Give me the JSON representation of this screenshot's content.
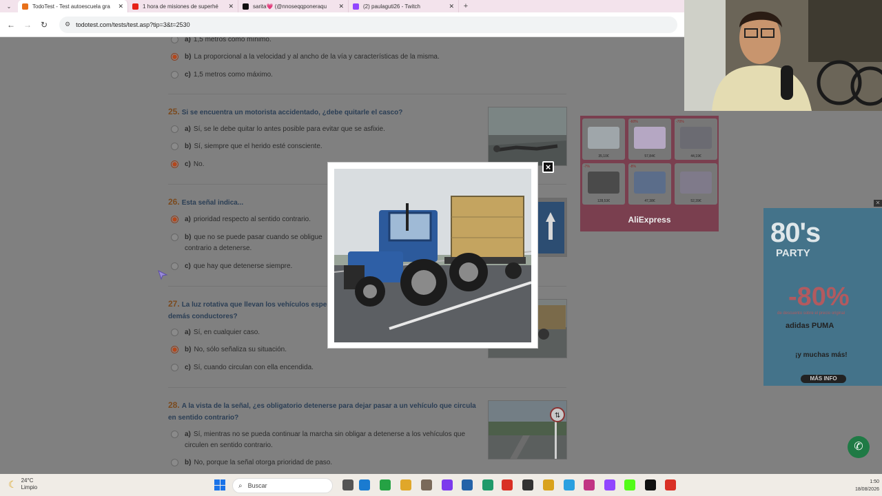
{
  "browser": {
    "tabs": [
      {
        "title": "TodoTest - Test autoescuela gra",
        "active": true,
        "favicon": "todotest-favicon",
        "color": "#e8711a"
      },
      {
        "title": "1 hora de misiones de superhé",
        "active": false,
        "favicon": "youtube-favicon",
        "color": "#e62117"
      },
      {
        "title": "sarita💗 (@nnoseqqponeraqu",
        "active": false,
        "favicon": "tiktok-favicon",
        "color": "#111111"
      },
      {
        "title": "(2) paulaguti26 - Twitch",
        "active": false,
        "favicon": "twitch-favicon",
        "color": "#9146ff"
      }
    ],
    "url": "todotest.com/tests/test.asp?tip=3&t=2530"
  },
  "questions": [
    {
      "number": "",
      "title": "",
      "options": [
        {
          "letter": "a)",
          "text": "1,5 metros como mínimo.",
          "checked": false
        },
        {
          "letter": "b)",
          "text": "La proporcional a la velocidad y al ancho de la vía y características de la misma.",
          "checked": true
        },
        {
          "letter": "c)",
          "text": "1,5 metros como máximo.",
          "checked": false
        }
      ]
    },
    {
      "number": "25.",
      "title": "Si se encuentra un motorista accidentado, ¿debe quitarle el casco?",
      "options": [
        {
          "letter": "a)",
          "text": "Sí, se le debe quitar lo antes posible para evitar que se asfixie.",
          "checked": false
        },
        {
          "letter": "b)",
          "text": "Sí, siempre que el herido esté consciente.",
          "checked": false
        },
        {
          "letter": "c)",
          "text": "No.",
          "checked": true
        }
      ]
    },
    {
      "number": "26.",
      "title": "Esta señal indica...",
      "options": [
        {
          "letter": "a)",
          "text": "prioridad respecto al sentido contrario.",
          "checked": true
        },
        {
          "letter": "b)",
          "text": "que no se puede pasar cuando se obligue",
          "text2": "contrario a detenerse.",
          "checked": false
        },
        {
          "letter": "c)",
          "text": "que hay que detenerse siempre.",
          "checked": false
        }
      ]
    },
    {
      "number": "27.",
      "title": "La luz rotativa que llevan los vehículos espe",
      "title2": "demás conductores?",
      "options": [
        {
          "letter": "a)",
          "text": "Sí, en cualquier caso.",
          "checked": false
        },
        {
          "letter": "b)",
          "text": "No, sólo señaliza su situación.",
          "checked": true
        },
        {
          "letter": "c)",
          "text": "Sí, cuando circulan con ella encendida.",
          "checked": false
        }
      ]
    },
    {
      "number": "28.",
      "title": "A la vista de la señal, ¿es obligatorio detenerse para dejar pasar a un vehículo que circula",
      "title2": "en sentido contrario?",
      "options": [
        {
          "letter": "a)",
          "text": "Sí, mientras no se pueda continuar la marcha sin obligar a detenerse a los vehículos que",
          "text2": "circulen en sentido contrario.",
          "checked": false
        },
        {
          "letter": "b)",
          "text": "No, porque la señal otorga prioridad de paso.",
          "checked": false
        }
      ]
    }
  ],
  "ads": {
    "aliexpress": {
      "brand": "AliExpress",
      "prices": [
        "35,10€",
        "57,84€",
        "44,19€",
        "128,53€",
        "47,38€",
        "52,39€"
      ],
      "badges": [
        "",
        "-60%",
        "-70%",
        "-7%",
        "-8%",
        ""
      ]
    },
    "party": {
      "headline": "80's",
      "subheadline": "PARTY",
      "discount": "-80%",
      "discount_note": "de descuento sobre el precio original",
      "brands": "adidas  PUMA",
      "more": "¡y muchas más!",
      "cta": "MÁS INFO"
    }
  },
  "modal": {
    "close_label": "×",
    "image": "blue-tractor-with-hay-trailer"
  },
  "taskbar": {
    "temperature": "24°C",
    "weather": "Limpio",
    "search_placeholder": "Buscar",
    "time": "1:50",
    "date": "18/08/2026"
  },
  "colors": {
    "overlay": "#808080",
    "question_title": "#2a3e55",
    "question_number": "#7b4a1e",
    "radio_checked": "#b3471c"
  }
}
